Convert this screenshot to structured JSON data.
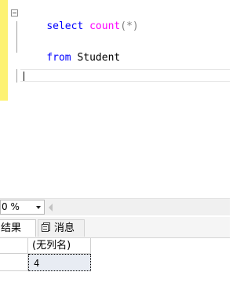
{
  "editor": {
    "lines": [
      {
        "tokens": [
          "select",
          " ",
          "count",
          "(",
          "*",
          ")"
        ]
      },
      {
        "tokens": [
          "from",
          " ",
          "Student"
        ]
      }
    ]
  },
  "zoom": {
    "value": "0 %"
  },
  "tabs": {
    "results_label": "结果",
    "messages_label": "消息"
  },
  "results": {
    "columns": [
      "(无列名)"
    ],
    "rows": [
      [
        "4"
      ]
    ]
  }
}
